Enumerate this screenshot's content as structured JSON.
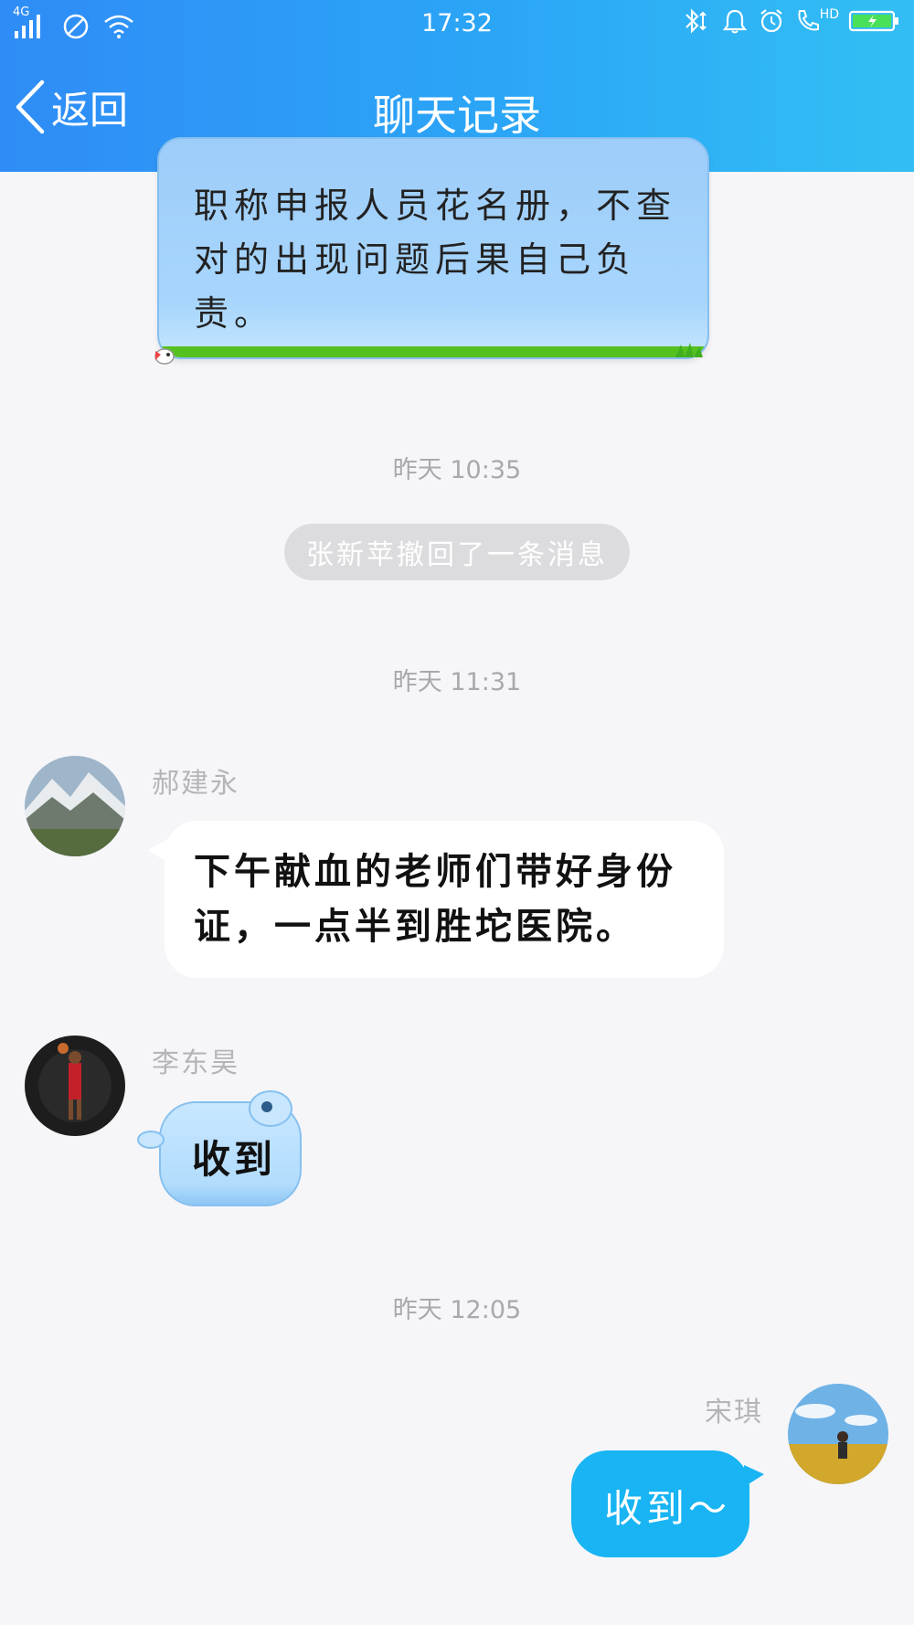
{
  "status_bar": {
    "network": "4G",
    "time": "17:32",
    "icons": [
      "signal-icon",
      "no-disturb-icon",
      "wifi-icon",
      "bluetooth-icon",
      "bell-icon",
      "alarm-icon",
      "hd-call-icon",
      "battery-icon"
    ],
    "hd_label": "HD"
  },
  "nav": {
    "back_label": "返回",
    "title": "聊天记录"
  },
  "messages": {
    "top_partial": {
      "text": "职称申报人员花名册，不查对的出现问题后果自己负责。"
    },
    "time_1": "昨天 10:35",
    "recall_notice": "张新苹撤回了一条消息",
    "time_2": "昨天 11:31",
    "msg1": {
      "sender": "郝建永",
      "text": "下午献血的老师们带好身份证，一点半到胜坨医院。"
    },
    "msg2": {
      "sender": "李东昊",
      "text": "收到"
    },
    "time_3": "昨天 12:05",
    "msg3": {
      "sender": "宋琪",
      "text": "收到～"
    }
  },
  "colors": {
    "header_start": "#2f8cf6",
    "header_end": "#32bff4",
    "own_bubble": "#18b4f3",
    "background": "#f6f6f9"
  }
}
